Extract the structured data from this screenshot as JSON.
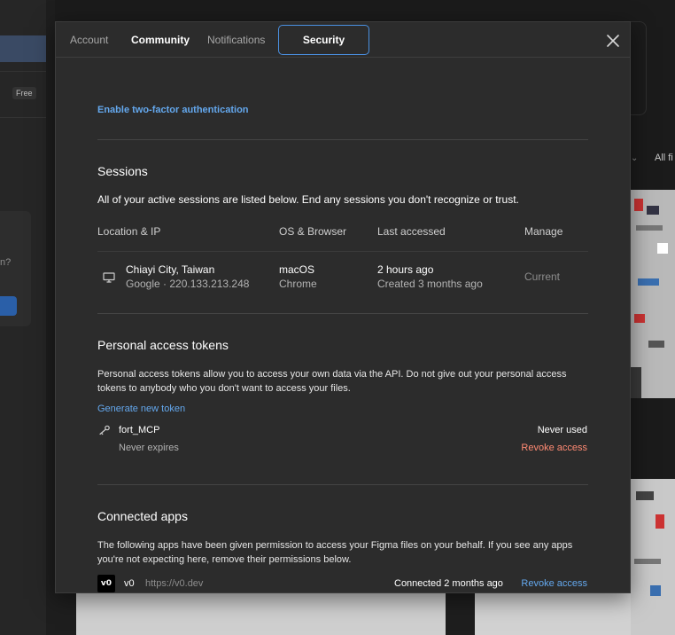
{
  "background": {
    "free_badge": "Free",
    "partial_question": "n?",
    "all_files_partial": "All fi"
  },
  "tabs": [
    {
      "label": "Account"
    },
    {
      "label": "Community"
    },
    {
      "label": "Notifications"
    },
    {
      "label": "Security",
      "active": true
    }
  ],
  "two_factor_link": "Enable two-factor authentication",
  "sessions": {
    "title": "Sessions",
    "description": "All of your active sessions are listed below. End any sessions you don't recognize or trust.",
    "columns": [
      "Location & IP",
      "OS & Browser",
      "Last accessed",
      "Manage"
    ],
    "rows": [
      {
        "icon": "monitor-icon",
        "location": "Chiayi City, Taiwan",
        "ip": "Google · 220.133.213.248",
        "os": "macOS",
        "browser": "Chrome",
        "last_accessed": "2 hours ago",
        "created": "Created 3 months ago",
        "manage": "Current"
      }
    ]
  },
  "tokens": {
    "title": "Personal access tokens",
    "description": "Personal access tokens allow you to access your own data via the API. Do not give out your personal access tokens to anybody who you don't want to access your files.",
    "generate_link": "Generate new token",
    "items": [
      {
        "icon": "key-icon",
        "name": "fort_MCP",
        "expires": "Never expires",
        "usage": "Never used",
        "revoke": "Revoke access"
      }
    ]
  },
  "apps": {
    "title": "Connected apps",
    "description": "The following apps have been given permission to access your Figma files on your behalf. If you see any apps you're not expecting here, remove their permissions below.",
    "items": [
      {
        "logo": "v0",
        "name": "v0",
        "url": "https://v0.dev",
        "connected": "Connected 2 months ago",
        "revoke": "Revoke access"
      }
    ]
  },
  "colors": {
    "accent": "#4a90e2",
    "link": "#64a8ee",
    "danger": "#ff8a73",
    "modal_bg": "#2c2c2c"
  }
}
